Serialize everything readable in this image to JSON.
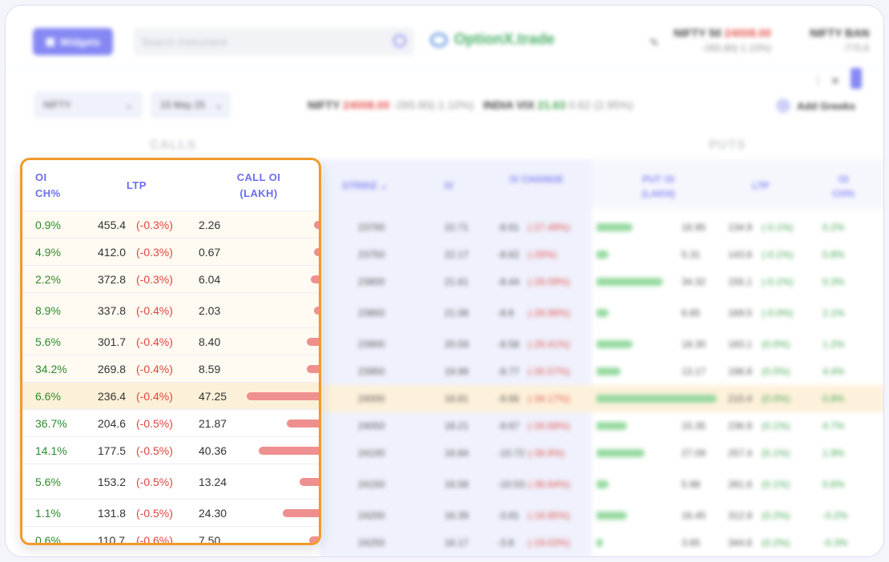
{
  "topbar": {
    "widgets_label": "Widgets",
    "search_placeholder": "Search Instrument",
    "brand": "OptionX.trade",
    "tickers": [
      {
        "name": "NIFTY 50",
        "price": "24008.00",
        "change": "-265.80(-1.10%)"
      },
      {
        "name": "NIFTY BAN",
        "price": "",
        "change": "-770.6"
      }
    ]
  },
  "controls": {
    "instrument": "NIFTY",
    "expiry": "15 May 25",
    "nifty_label": "NIFTY",
    "nifty_price": "24008.00",
    "nifty_change": "-265.80(-1.10%)",
    "vix_label": "INDIA VIX",
    "vix_price": "21.63",
    "vix_change": "0.62 (2.95%)",
    "add_greeks": "Add Greeks"
  },
  "sections": {
    "calls": "CALLS",
    "puts": "PUTS"
  },
  "columns": {
    "oi_ch": "OI CH%",
    "ltp": "LTP",
    "call_oi": "CALL OI (LAKH)",
    "strike": "STRIKE",
    "iv": "IV",
    "iv_change": "IV CHANGE",
    "put_oi": "PUT OI (LAKH)",
    "put_ltp": "LTP",
    "put_oi_ch": "OI CH%"
  },
  "calls": [
    {
      "oi_ch": "0.9%",
      "ltp": "455.4",
      "chg": "(-0.3%)",
      "call_oi": "2.26",
      "bar": 0.03
    },
    {
      "oi_ch": "4.9%",
      "ltp": "412.0",
      "chg": "(-0.3%)",
      "call_oi": "0.67",
      "bar": 0.0
    },
    {
      "oi_ch": "2.2%",
      "ltp": "372.8",
      "chg": "(-0.3%)",
      "call_oi": "6.04",
      "bar": 0.1
    },
    {
      "oi_ch": "8.9%",
      "ltp": "337.8",
      "chg": "(-0.4%)",
      "call_oi": "2.03",
      "bar": 0.03
    },
    {
      "oi_ch": "5.6%",
      "ltp": "301.7",
      "chg": "(-0.4%)",
      "call_oi": "8.40",
      "bar": 0.15
    },
    {
      "oi_ch": "34.2%",
      "ltp": "269.8",
      "chg": "(-0.4%)",
      "call_oi": "8.59",
      "bar": 0.15
    },
    {
      "oi_ch": "6.6%",
      "ltp": "236.4",
      "chg": "(-0.4%)",
      "call_oi": "47.25",
      "bar": 0.9
    },
    {
      "oi_ch": "36.7%",
      "ltp": "204.6",
      "chg": "(-0.5%)",
      "call_oi": "21.87",
      "bar": 0.4
    },
    {
      "oi_ch": "14.1%",
      "ltp": "177.5",
      "chg": "(-0.5%)",
      "call_oi": "40.36",
      "bar": 0.75
    },
    {
      "oi_ch": "5.6%",
      "ltp": "153.2",
      "chg": "(-0.5%)",
      "call_oi": "13.24",
      "bar": 0.24
    },
    {
      "oi_ch": "1.1%",
      "ltp": "131.8",
      "chg": "(-0.5%)",
      "call_oi": "24.30",
      "bar": 0.45
    },
    {
      "oi_ch": "0.6%",
      "ltp": "110.7",
      "chg": "(-0.6%)",
      "call_oi": "7.50",
      "bar": 0.12
    }
  ],
  "strikes": [
    {
      "strike": "23700",
      "iv": "22.71",
      "ivc": "-8.61",
      "ivcp": "(-27.49%)",
      "put_oi": "16.95",
      "put_ltp": "134.9",
      "put_chg": "(-0.1%)",
      "put_oich": "0.2%",
      "put_bar": 0.3
    },
    {
      "strike": "23750",
      "iv": "22.17",
      "ivc": "-8.62",
      "ivcp": "(-28%)",
      "put_oi": "5.31",
      "put_ltp": "143.6",
      "put_chg": "(-0.1%)",
      "put_oich": "0.8%",
      "put_bar": 0.1
    },
    {
      "strike": "23800",
      "iv": "21.61",
      "ivc": "-8.44",
      "ivcp": "(-28.09%)",
      "put_oi": "34.32",
      "put_ltp": "155.1",
      "put_chg": "(-0.1%)",
      "put_oich": "0.3%",
      "put_bar": 0.55
    },
    {
      "strike": "23850",
      "iv": "21.08",
      "ivc": "-8.6",
      "ivcp": "(-28.98%)",
      "put_oi": "6.65",
      "put_ltp": "169.5",
      "put_chg": "(-0.0%)",
      "put_oich": "2.1%",
      "put_bar": 0.1
    },
    {
      "strike": "23900",
      "iv": "20.59",
      "ivc": "-8.58",
      "ivcp": "(-29.41%)",
      "put_oi": "18.30",
      "put_ltp": "183.1",
      "put_chg": "(0.0%)",
      "put_oich": "1.2%",
      "put_bar": 0.3
    },
    {
      "strike": "23950",
      "iv": "19.99",
      "ivc": "-8.77",
      "ivcp": "(-30.57%)",
      "put_oi": "13.17",
      "put_ltp": "198.8",
      "put_chg": "(0.0%)",
      "put_oich": "4.4%",
      "put_bar": 0.2
    },
    {
      "strike": "24000",
      "iv": "18.81",
      "ivc": "-9.66",
      "ivcp": "(-34.17%)",
      "put_oi": "72.81",
      "put_ltp": "215.4",
      "put_chg": "(0.0%)",
      "put_oich": "0.8%",
      "put_bar": 1.0
    },
    {
      "strike": "24050",
      "iv": "18.21",
      "ivc": "-9.67",
      "ivcp": "(-34.68%)",
      "put_oi": "15.35",
      "put_ltp": "236.9",
      "put_chg": "(0.1%)",
      "put_oich": "4.7%",
      "put_bar": 0.25
    },
    {
      "strike": "24100",
      "iv": "16.84",
      "ivc": "-10.72",
      "ivcp": "(-38.9%)",
      "put_oi": "27.09",
      "put_ltp": "257.4",
      "put_chg": "(0.1%)",
      "put_oich": "1.9%",
      "put_bar": 0.4
    },
    {
      "strike": "24150",
      "iv": "16.58",
      "ivc": "-10.53",
      "ivcp": "(-38.84%)",
      "put_oi": "5.98",
      "put_ltp": "281.6",
      "put_chg": "(0.1%)",
      "put_oich": "0.6%",
      "put_bar": 0.1
    },
    {
      "strike": "24200",
      "iv": "16.39",
      "ivc": "-3.81",
      "ivcp": "(-18.85%)",
      "put_oi": "16.45",
      "put_ltp": "312.9",
      "put_chg": "(0.2%)",
      "put_oich": "-0.2%",
      "put_bar": 0.25
    },
    {
      "strike": "24250",
      "iv": "16.17",
      "ivc": "-3.8",
      "ivcp": "(-19.03%)",
      "put_oi": "3.65",
      "put_ltp": "344.6",
      "put_chg": "(0.2%)",
      "put_oich": "-0.3%",
      "put_bar": 0.05
    }
  ]
}
